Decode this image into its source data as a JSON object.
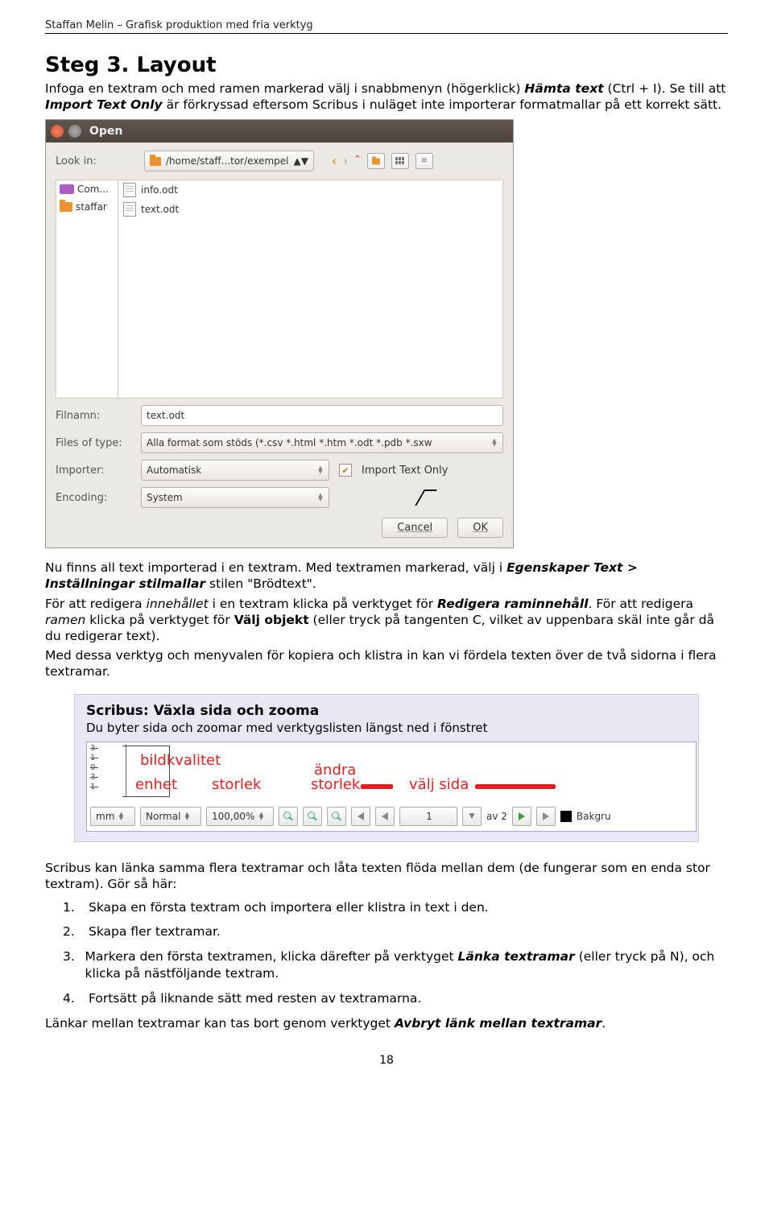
{
  "header": "Staffan Melin – Grafisk produktion med fria verktyg",
  "page_number": "18",
  "intro": {
    "title": "Steg 3. Layout",
    "p1a": "Infoga en textram och med ramen markerad välj i snabbmenyn (högerklick) ",
    "p1b": "Hämta text",
    "p1c": " (Ctrl + I). Se till att ",
    "p1d": "Import Text Only",
    "p1e": " är förkryssad eftersom Scribus i nuläget inte importerar formatmallar på ett korrekt sätt."
  },
  "dialog": {
    "title": "Open",
    "look_in_label": "Look in:",
    "path": "/home/staff...tor/exempel",
    "places": [
      {
        "icon": "monitor",
        "label": "Com..."
      },
      {
        "icon": "folder",
        "label": "staffar"
      }
    ],
    "files": [
      "info.odt",
      "text.odt"
    ],
    "filnamn_label": "Filnamn:",
    "filnamn_value": "text.odt",
    "files_of_type_label": "Files of type:",
    "files_of_type_value": "Alla format som stöds (*.csv *.html *.htm *.odt *.pdb *.sxw",
    "importer_label": "Importer:",
    "importer_value": "Automatisk",
    "import_text_only_label": "Import Text Only",
    "encoding_label": "Encoding:",
    "encoding_value": "System",
    "cancel": "Cancel",
    "ok": "OK"
  },
  "after_dialog": {
    "p1a": "Nu finns all text importerad i en textram. Med textramen markerad, välj i ",
    "p1b": "Egenskaper Text > Inställningar stilmallar",
    "p1c": " stilen \"Brödtext\".",
    "p2a": "För att redigera ",
    "p2b": "innehållet",
    "p2c": " i en textram klicka på verktyget för ",
    "p2d": "Redigera raminnehåll",
    "p2e": ". För att redigera ",
    "p2f": "ramen",
    "p2g": " klicka på verktyget för ",
    "p2h": "Välj objekt",
    "p2i": " (eller tryck på tangenten C, vilket av uppenbara skäl inte går då du redigerar text).",
    "p3": "Med dessa verktyg och menyvalen för kopiera och klistra in kan vi fördela texten över de två sidorna i flera textramar."
  },
  "callout": {
    "title": "Scribus: Växla sida och zooma",
    "body": "Du byter sida och zoomar med verktygslisten längst ned i fönstret",
    "annotations": {
      "bildkvalitet": "bildkvalitet",
      "enhet": "enhet",
      "andra": "ändra",
      "storlek1": "storlek",
      "storlek2": "storlek",
      "valj_sida": "välj sida"
    },
    "status": {
      "unit": "mm",
      "quality": "Normal",
      "zoom": "100,00%",
      "page": "1",
      "of": "av 2",
      "bg": "Bakgru"
    }
  },
  "bottom": {
    "p1": "Scribus kan länka samma flera textramar och låta texten flöda mellan dem (de fungerar som en enda stor textram). Gör så här:",
    "list": [
      "Skapa en första textram och importera eller klistra in text i den.",
      "Skapa fler textramar.",
      {
        "a": "Markera den första textramen, klicka därefter på verktyget ",
        "b": "Länka textramar",
        "c": " (eller tryck på N), och klicka på nästföljande textram."
      },
      "Fortsätt på liknande sätt med resten av textramarna."
    ],
    "p2a": "Länkar mellan textramar kan tas bort genom verktyget ",
    "p2b": "Avbryt länk mellan textramar",
    "p2c": "."
  }
}
